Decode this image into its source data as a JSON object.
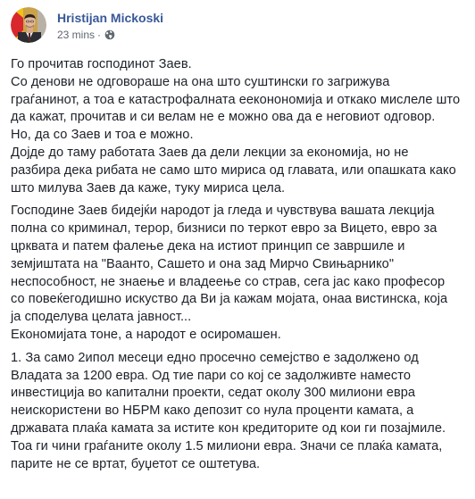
{
  "post": {
    "author": "Hristijan Mickoski",
    "time": "23 mins",
    "separator": "·",
    "privacy_icon": "globe-icon",
    "avatar_icon": "profile-photo-avatar",
    "paragraphs": [
      {
        "lines": [
          "Го прочитав господинот Заев.",
          "Со денови не одговораше на она што суштински го загрижува",
          "граѓанинот, а тоа е катастрофалната ееконономија и откако мислеле што",
          "да кажат, прочитав и си велам не е можно ова да е неговиот одговор.",
          "Но, да со Заев и тоа е можно.",
          "Дојде до таму работата Заев да дели лекции за економија, но не",
          "разбира дека рибата не само што мириса од главата, или опашката како",
          "што милува Заев да каже, туку мириса цела."
        ]
      },
      {
        "lines": [
          "Господине Заев бидејќи народот ја гледа и чувствува вашата лекција",
          "полна со криминал, терор, бизниси по теркот евро за Вицето, евро за",
          "црквата и патем фалење дека на истиот принцип се завршиле и",
          "земјиштата на \"Ваанто, Сашето и она зад Мирчо Свињарнико\"",
          "неспособност, не знаење и владеење со страв, сега јас како професор",
          "со повеќегодишно искуство да Ви ја кажам мојата, онаа вистинска, која",
          "ја споделува целата јавност...",
          "Економијата тоне, а народот е осиромашен."
        ]
      },
      {
        "lines": [
          "1. За само 2ипол месеци едно просечно семејство е задолжено од",
          "Владата за 1200 евра. Од тие пари со кој се задолживте наместо",
          "инвестиција во капитални проекти, седат околу 300 милиони евра",
          "неискористени во НБРМ како депозит со нула проценти камата, а",
          "државата плаќа камата за истите кон кредиторите од кои ги позајмиле.",
          "Тоа ги чини граѓаните околу 1.5 милиони евра. Значи се плаќа камата,",
          "парите не се вртат, буџетот се оштетува."
        ]
      }
    ]
  },
  "colors": {
    "author": "#385898",
    "meta": "#606770",
    "text": "#1d2129",
    "background": "#ffffff"
  }
}
